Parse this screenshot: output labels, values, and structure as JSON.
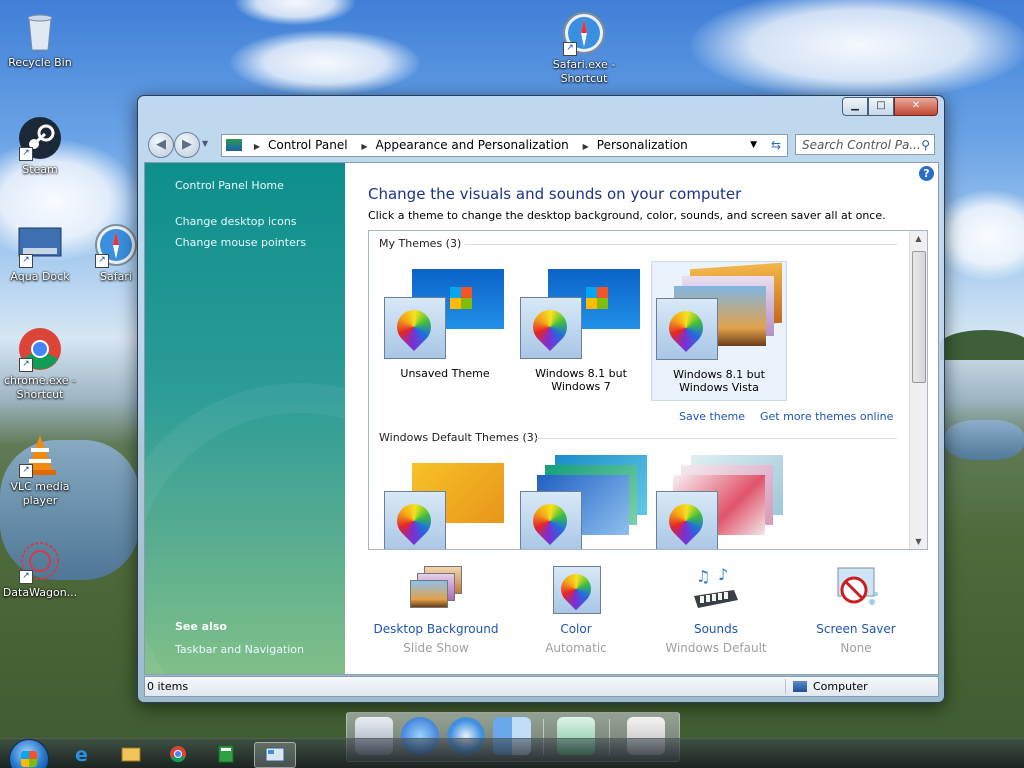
{
  "desktop": {
    "icons": [
      {
        "label": "Recycle Bin",
        "icon": "recycle-bin-icon"
      },
      {
        "label": "Safari.exe - Shortcut",
        "icon": "safari-icon"
      },
      {
        "label": "Steam",
        "icon": "steam-icon"
      },
      {
        "label": "Aqua Dock",
        "icon": "aqua-dock-icon"
      },
      {
        "label": "Safari",
        "icon": "safari-icon"
      },
      {
        "label": "chrome.exe - Shortcut",
        "icon": "chrome-icon"
      },
      {
        "label": "VLC media player",
        "icon": "vlc-icon"
      },
      {
        "label": "DataWagon...",
        "icon": "datawagon-icon"
      }
    ]
  },
  "window": {
    "breadcrumb": [
      "Control Panel",
      "Appearance and Personalization",
      "Personalization"
    ],
    "search_placeholder": "Search Control Pa...",
    "left_pane": {
      "home": "Control Panel Home",
      "links": [
        "Change desktop icons",
        "Change mouse pointers"
      ],
      "see_also_title": "See also",
      "see_also_links": [
        "Taskbar and Navigation"
      ]
    },
    "heading": "Change the visuals and sounds on your computer",
    "subheading": "Click a theme to change the desktop background, color, sounds, and screen saver all at once.",
    "my_themes": {
      "title": "My Themes (3)",
      "items": [
        "Unsaved Theme",
        "Windows 8.1 but Windows 7",
        "Windows 8.1 but Windows Vista"
      ],
      "selected_index": 2
    },
    "theme_links": {
      "save": "Save theme",
      "more": "Get more themes online"
    },
    "default_themes": {
      "title": "Windows Default Themes (3)"
    },
    "bottom_items": [
      {
        "label": "Desktop Background",
        "sub": "Slide Show",
        "icon": "desktop-background-icon"
      },
      {
        "label": "Color",
        "sub": "Automatic",
        "icon": "color-palette-icon"
      },
      {
        "label": "Sounds",
        "sub": "Windows Default",
        "icon": "sounds-icon"
      },
      {
        "label": "Screen Saver",
        "sub": "None",
        "icon": "screen-saver-icon"
      }
    ],
    "status": {
      "items": "0 items",
      "location": "Computer"
    }
  },
  "dock": {
    "items": [
      "mail-icon",
      "internet-explorer-icon",
      "safari-icon",
      "finder-icon",
      "recycle-icon",
      "boot-camp-icon"
    ]
  },
  "taskbar": {
    "items": [
      "start-orb",
      "internet-explorer-icon",
      "file-explorer-icon",
      "chrome-icon",
      "calculator-icon",
      "control-panel-icon"
    ]
  }
}
